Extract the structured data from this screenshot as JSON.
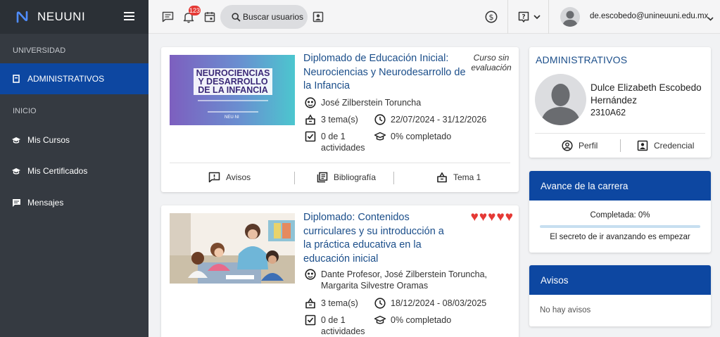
{
  "app": {
    "brand": "NEUUNI"
  },
  "sidebar": {
    "sections": [
      {
        "label": "UNIVERSIDAD"
      },
      {
        "label": "INICIO"
      }
    ],
    "items": [
      {
        "label": "ADMINISTRATIVOS",
        "icon": "document-icon",
        "active": true
      },
      {
        "label": "Mis Cursos",
        "icon": "graduation-cap-icon"
      },
      {
        "label": "Mis Certificados",
        "icon": "graduation-cap-icon"
      },
      {
        "label": "Mensajes",
        "icon": "chat-icon"
      }
    ]
  },
  "topbar": {
    "notification_count": "123",
    "search_label": "Buscar usuarios",
    "user_email": "de.escobedo@unineuuni.edu.mx"
  },
  "courses": [
    {
      "title": "Diplomado de Educación Inicial: Neurociencias y Neurodesarrollo de la Infancia",
      "note": "Curso sin evaluación",
      "thumb_title": "NEUROCIENCIAS Y DESARROLLO DE LA INFANCIA",
      "thumb_brand": "NEU·NI",
      "instructors": "José Zilberstein Toruncha",
      "topics": "3 tema(s)",
      "dates": "22/07/2024 - 31/12/2026",
      "activities": "0 de 1 actividades",
      "progress": "0% completado",
      "footer": {
        "avisos": "Avisos",
        "bibliografia": "Bibliografía",
        "tema": "Tema 1"
      }
    },
    {
      "title": "Diplomado: Contenidos curriculares y su introducción a la práctica educativa en la educación inicial",
      "rating": 5,
      "instructors": "Dante Profesor, José Zilberstein Toruncha, Margarita Silvestre Oramas",
      "topics": "3 tema(s)",
      "dates": "18/12/2024 - 08/03/2025",
      "activities": "0 de 1 actividades",
      "progress": "0% completado"
    }
  ],
  "profile": {
    "heading": "ADMINISTRATIVOS",
    "name": "Dulce Elizabeth Escobedo Hernández",
    "id": "2310A62",
    "perfil_label": "Perfil",
    "credencial_label": "Credencial"
  },
  "career": {
    "heading": "Avance de la carrera",
    "completed": "Completada: 0%",
    "completed_fraction": 0,
    "motto": "El secreto de ir avanzando es empezar"
  },
  "notices": {
    "heading": "Avisos",
    "empty": "No hay avisos"
  },
  "colors": {
    "primary": "#0d47a1",
    "sidebar": "#353a41",
    "link": "#1b4e8a",
    "heart": "#e53935"
  }
}
